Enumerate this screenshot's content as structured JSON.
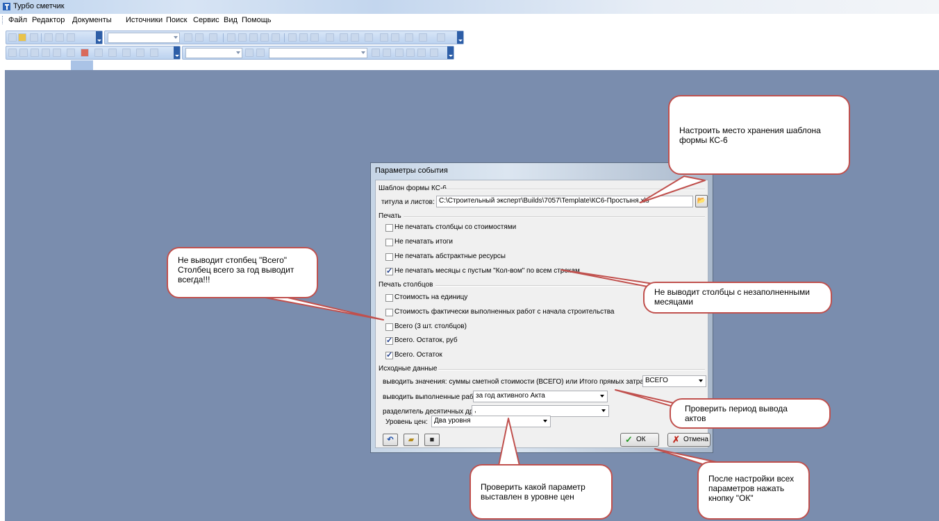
{
  "window": {
    "title": "Турбо сметчик"
  },
  "menu": [
    "Файл",
    "Редактор",
    "Документы",
    "Источники",
    "Поиск",
    "Сервис",
    "Вид",
    "Помощь"
  ],
  "dialog": {
    "title": "Параметры события",
    "template_group": "Шаблон формы КС-6",
    "template_label": "титула и листов:",
    "template_path": "C:\\Строительный эксперт\\Builds\\7057\\Template\\КС6-Простыня.xls",
    "print_group": "Печать",
    "print_options": [
      {
        "label": "Не печатать столбцы со стоимостями",
        "checked": false
      },
      {
        "label": "Не печатать итоги",
        "checked": false
      },
      {
        "label": "Не печатать абстрактные ресурсы",
        "checked": false
      },
      {
        "label": "Не печатать месяцы с пустым \"Кол-вом\" по всем строкам",
        "checked": true
      }
    ],
    "columns_group": "Печать столбцов",
    "column_options": [
      {
        "label": "Стоимость на единицу",
        "checked": false
      },
      {
        "label": "Стоимость фактически выполненных работ с начала строительства",
        "checked": false
      },
      {
        "label": "Всего (3 шт. столбцов)",
        "checked": false
      },
      {
        "label": "Всего. Остаток, руб",
        "checked": true
      },
      {
        "label": "Всего. Остаток",
        "checked": true
      }
    ],
    "source_group": "Исходные данные",
    "output_values_label": "выводить значения: суммы сметной стоимости (ВСЕГО) или Итого прямых затрат (ИПЗ):",
    "output_values": "ВСЕГО",
    "output_works_label": "выводить выполненные работы:",
    "output_works": "за год активного Акта",
    "decimal_sep_label": "разделитель десятичных дробей:",
    "decimal_sep": ",",
    "price_level_label": "Уровень цен:",
    "price_level": "Два уровня",
    "ok_label": "ОК",
    "cancel_label": "Отмена"
  },
  "callouts": {
    "storage": [
      "Настроить место хранения шаблона",
      "формы КС-6"
    ],
    "total_column": [
      "Не выводит стопбец \"Всего\"",
      "Столбец всего за год выводит",
      "всегда!!!"
    ],
    "empty_months": [
      "Не выводит столбцы с незаполненными",
      "месяцами"
    ],
    "period": [
      "Проверить период вывода",
      "актов"
    ],
    "price_level": [
      "Проверить какой параметр",
      "выставлен в уровне цен"
    ],
    "ok_hint": [
      "После настройки всех",
      "параметров нажать",
      "кнопку \"ОК\""
    ]
  },
  "colors": {
    "workspace": "#7a8dae",
    "callout_border": "#c0504d",
    "toolbar": "#c6d9f1"
  }
}
